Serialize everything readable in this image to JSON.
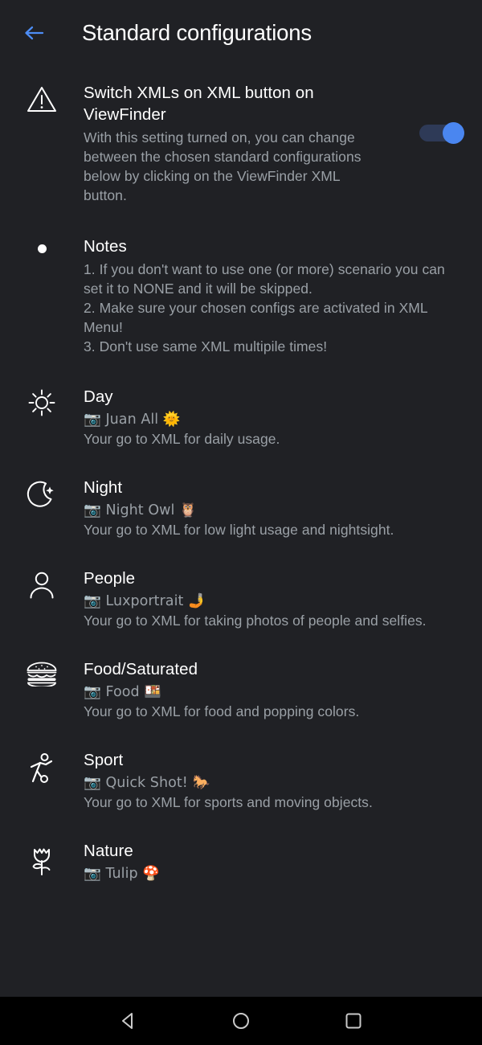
{
  "appbar": {
    "title": "Standard configurations",
    "back_icon": "arrow-left-icon",
    "back_color": "#4d8df5"
  },
  "colors": {
    "background": "#202125",
    "title_text": "#ffffff",
    "summary_text": "#9aa0a6",
    "accent": "#4a86f0",
    "toggle_track": "#2e3a57",
    "navbar_background": "#000000"
  },
  "switch_pref": {
    "icon": "warning-triangle-icon",
    "title": "Switch XMLs on XML button on ViewFinder",
    "summary": "With this setting turned on, you can change between the chosen standard configurations below by clicking on the ViewFinder XML button.",
    "toggle_state": "on"
  },
  "notes_pref": {
    "icon": "bullet-dot-icon",
    "title": "Notes",
    "lines": [
      "1. If you don't want to use one (or more) scenario you can set it to NONE and it will be skipped.",
      "2. Make sure your chosen configs are activated in XML Menu!",
      "3. Don't use same XML multipile times!"
    ]
  },
  "configs": [
    {
      "icon": "sun-icon",
      "title": "Day",
      "value": "📷 Juan All 🌞",
      "description": "Your go to XML for daily usage."
    },
    {
      "icon": "moon-star-icon",
      "title": "Night",
      "value": "📷 Night Owl 🦉",
      "description": "Your go to XML for low light usage and nightsight."
    },
    {
      "icon": "person-icon",
      "title": "People",
      "value": "📷 Luxportrait 🤳",
      "description": "Your go to XML for taking photos of people and selfies."
    },
    {
      "icon": "burger-icon",
      "title": "Food/Saturated",
      "value": "📷 Food 🍱",
      "description": "Your go to XML for food and popping colors."
    },
    {
      "icon": "sport-icon",
      "title": "Sport",
      "value": "📷 Quick Shot! 🐎",
      "description": "Your go to XML for sports and moving objects."
    },
    {
      "icon": "tulip-icon",
      "title": "Nature",
      "value": "📷 Tulip 🍄",
      "description": ""
    }
  ],
  "navbar": {
    "back_label": "back-triangle-icon",
    "home_label": "home-circle-icon",
    "recents_label": "recents-square-icon"
  }
}
